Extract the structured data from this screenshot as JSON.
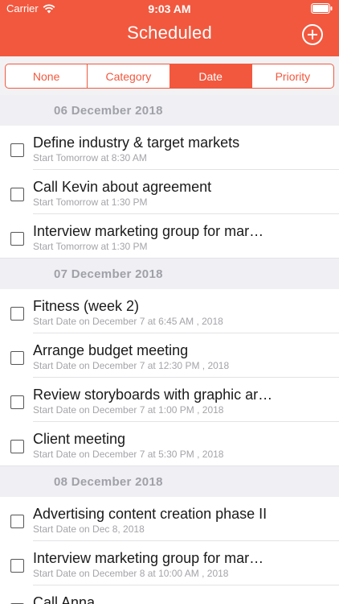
{
  "status_bar": {
    "carrier": "Carrier",
    "time": "9:03 AM",
    "wifi_icon": "wifi-icon",
    "battery_icon": "battery-icon"
  },
  "header": {
    "title": "Scheduled",
    "add_icon": "add-circle-icon"
  },
  "accent_color": "#f2583e",
  "segments": [
    {
      "label": "None",
      "active": false
    },
    {
      "label": "Category",
      "active": false
    },
    {
      "label": "Date",
      "active": true
    },
    {
      "label": "Priority",
      "active": false
    }
  ],
  "sections": [
    {
      "header": "06 December 2018",
      "tasks": [
        {
          "title": "Define industry & target markets",
          "subtitle": "Start Tomorrow at 8:30 AM"
        },
        {
          "title": "Call Kevin about agreement",
          "subtitle": "Start Tomorrow at 1:30 PM"
        },
        {
          "title": "Interview marketing group for mar…",
          "subtitle": "Start Tomorrow at 1:30 PM"
        }
      ]
    },
    {
      "header": "07 December 2018",
      "tasks": [
        {
          "title": "Fitness (week 2)",
          "subtitle": "Start Date on December 7 at 6:45 AM , 2018"
        },
        {
          "title": "Arrange budget meeting",
          "subtitle": "Start Date on December 7 at 12:30 PM , 2018"
        },
        {
          "title": "Review storyboards with graphic ar…",
          "subtitle": "Start Date on December 7 at 1:00 PM , 2018"
        },
        {
          "title": "Client meeting",
          "subtitle": "Start Date on December 7 at 5:30 PM , 2018"
        }
      ]
    },
    {
      "header": "08 December 2018",
      "tasks": [
        {
          "title": "Advertising content creation phase II",
          "subtitle": "Start Date on Dec 8, 2018"
        },
        {
          "title": "Interview marketing group for mar…",
          "subtitle": "Start Date on December 8 at 10:00 AM , 2018"
        },
        {
          "title": "Call Anna",
          "subtitle": ""
        }
      ]
    }
  ]
}
